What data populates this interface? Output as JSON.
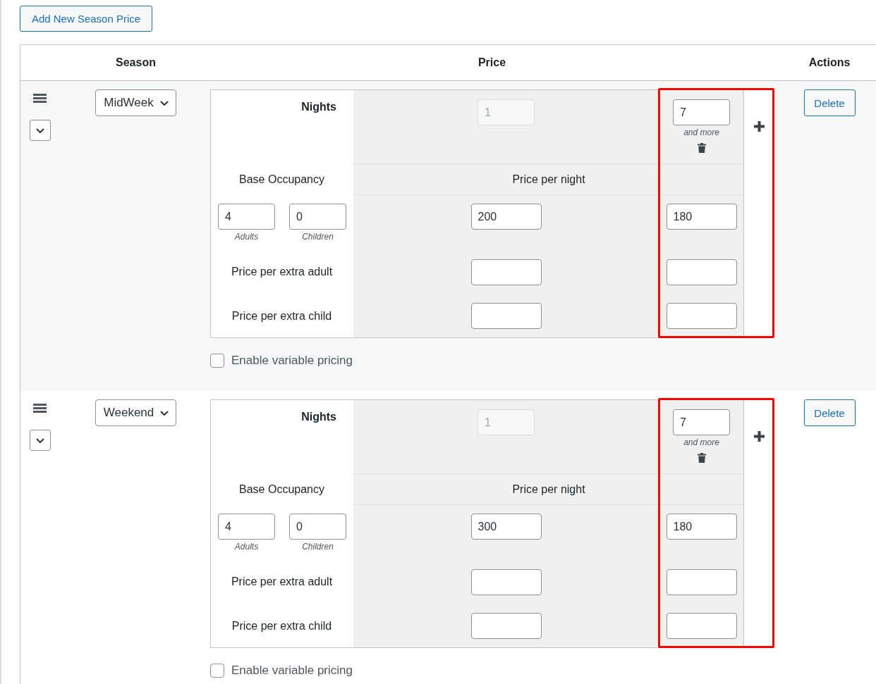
{
  "add_button": {
    "label": "Add New Season Price"
  },
  "table": {
    "columns": [
      {
        "label": "Season"
      },
      {
        "label": "Price"
      },
      {
        "label": "Actions"
      }
    ],
    "rows": [
      {
        "season": "MidWeek",
        "price": {
          "nights_label": "Nights",
          "base_occupancy_label": "Base Occupancy",
          "price_per_night_label": "Price per night",
          "extra_adult_label": "Price per extra adult",
          "extra_child_label": "Price per extra child",
          "adults": {
            "value": "4",
            "caption": "Adults"
          },
          "children": {
            "value": "0",
            "caption": "Children"
          },
          "tiers": [
            {
              "nights": "1",
              "disabled": true,
              "deletable": false,
              "highlighted": false,
              "price_per_night": "200"
            },
            {
              "nights": "7",
              "disabled": false,
              "suffix": "and more",
              "deletable": true,
              "highlighted": true,
              "price_per_night": "180"
            }
          ]
        },
        "variable_pricing": {
          "label": "Enable variable pricing",
          "checked": false
        },
        "action": "Delete"
      },
      {
        "season": "Weekend",
        "price": {
          "nights_label": "Nights",
          "base_occupancy_label": "Base Occupancy",
          "price_per_night_label": "Price per night",
          "extra_adult_label": "Price per extra adult",
          "extra_child_label": "Price per extra child",
          "adults": {
            "value": "4",
            "caption": "Adults"
          },
          "children": {
            "value": "0",
            "caption": "Children"
          },
          "tiers": [
            {
              "nights": "1",
              "disabled": true,
              "deletable": false,
              "highlighted": false,
              "price_per_night": "300"
            },
            {
              "nights": "7",
              "disabled": false,
              "suffix": "and more",
              "deletable": true,
              "highlighted": true,
              "price_per_night": "180"
            }
          ]
        },
        "variable_pricing": {
          "label": "Enable variable pricing",
          "checked": false
        },
        "action": "Delete"
      }
    ]
  }
}
